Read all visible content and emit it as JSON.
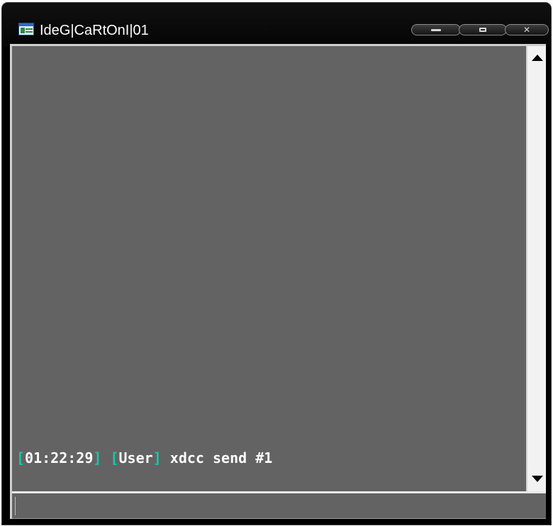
{
  "window": {
    "title": "IdeG|CaRtOnI|01",
    "app_icon": "irc-channel-icon",
    "buttons": [
      "minimize-icon",
      "maximize-icon",
      "close-icon"
    ]
  },
  "messages": [
    {
      "timestamp": "01:22:29",
      "nick": "User",
      "text": "xdcc send #1"
    }
  ],
  "input": {
    "value": ""
  },
  "colors": {
    "bracket": "#19c6a8",
    "background": "#636363",
    "text": "#ffffff",
    "titlebar": "#000000"
  }
}
